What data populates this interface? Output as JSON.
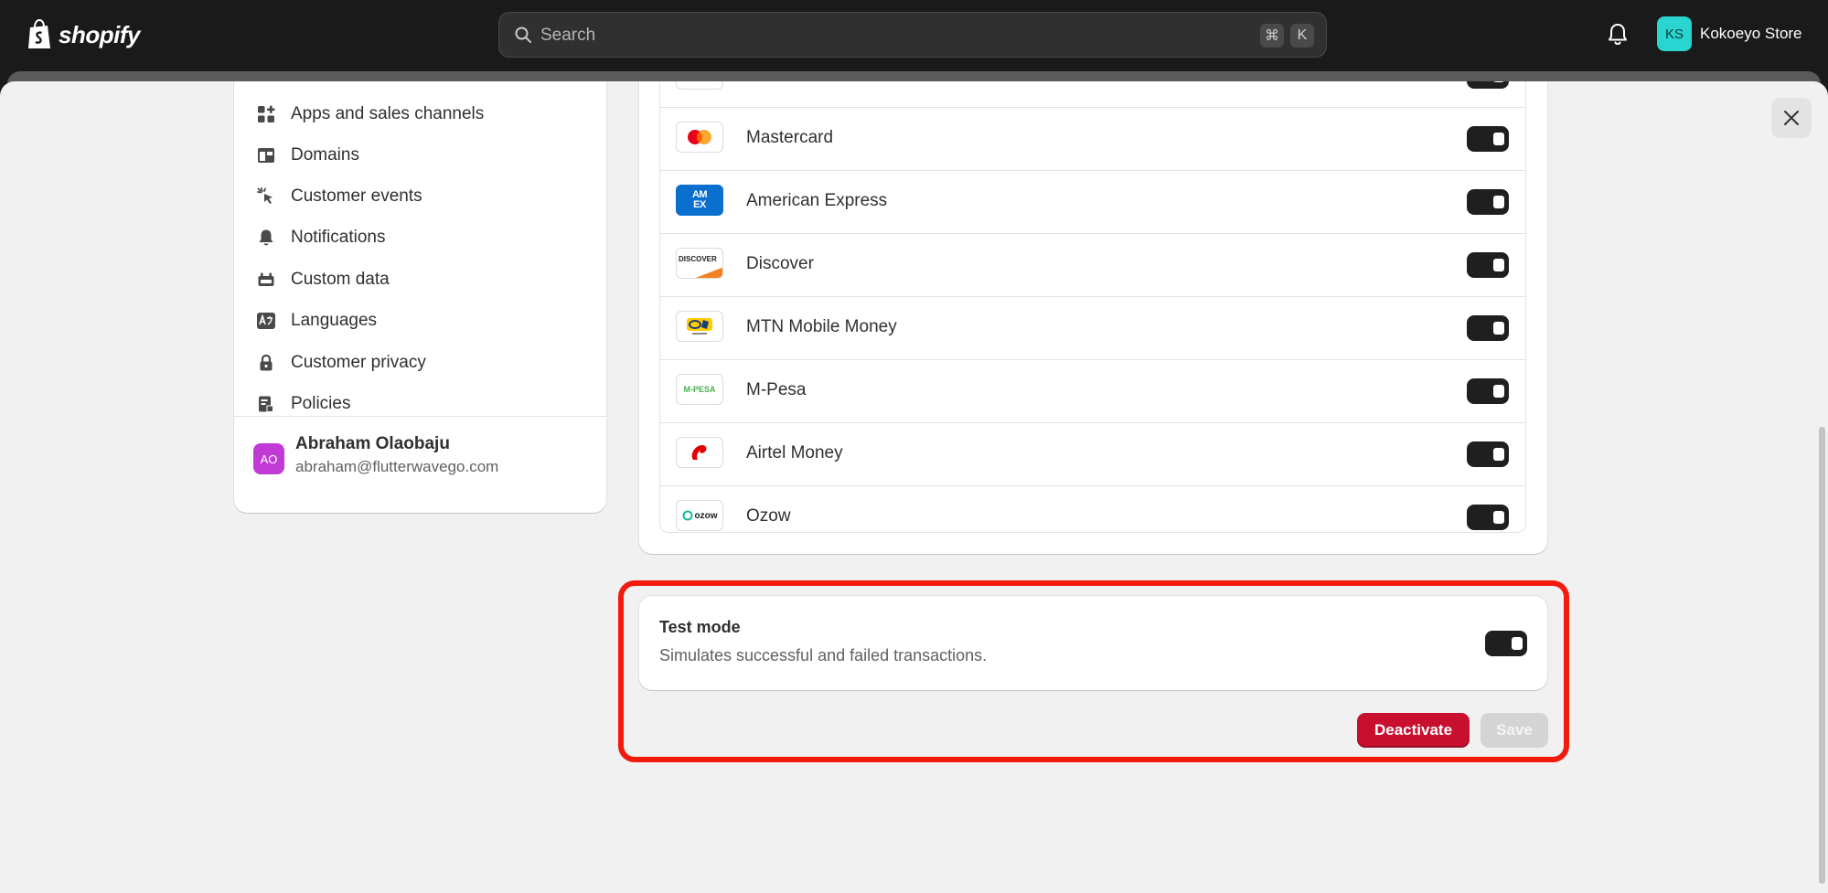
{
  "topbar": {
    "brand": "shopify",
    "search_placeholder": "Search",
    "shortcut_cmd": "⌘",
    "shortcut_key": "K",
    "store_initials": "KS",
    "store_name": "Kokoeyo Store"
  },
  "sidebar": {
    "items": [
      {
        "label": "Apps and sales channels",
        "icon": "apps-icon"
      },
      {
        "label": "Domains",
        "icon": "domains-icon"
      },
      {
        "label": "Customer events",
        "icon": "cursor-click-icon"
      },
      {
        "label": "Notifications",
        "icon": "bell-icon"
      },
      {
        "label": "Custom data",
        "icon": "custom-data-icon"
      },
      {
        "label": "Languages",
        "icon": "language-icon"
      },
      {
        "label": "Customer privacy",
        "icon": "lock-icon"
      },
      {
        "label": "Policies",
        "icon": "policies-icon"
      }
    ],
    "user": {
      "initials": "AO",
      "name": "Abraham Olaobaju",
      "email": "abraham@flutterwavego.com"
    }
  },
  "payment_methods": [
    {
      "name": "Mastercard",
      "enabled": true
    },
    {
      "name": "American Express",
      "enabled": true
    },
    {
      "name": "Discover",
      "enabled": true
    },
    {
      "name": "MTN Mobile Money",
      "enabled": true
    },
    {
      "name": "M-Pesa",
      "enabled": true
    },
    {
      "name": "Airtel Money",
      "enabled": true
    },
    {
      "name": "Ozow",
      "enabled": true
    }
  ],
  "logo_text": {
    "amex": "AM EX",
    "discover": "DISCOVER",
    "mpesa": "M-PESA",
    "ozow": "ozow"
  },
  "test_mode": {
    "title": "Test mode",
    "description": "Simulates successful and failed transactions.",
    "enabled": true
  },
  "actions": {
    "deactivate_label": "Deactivate",
    "save_label": "Save"
  },
  "colors": {
    "highlight": "#f31a0e",
    "deactivate": "#c8102e",
    "store_avatar": "#2ad4d0",
    "user_avatar": "#c13ad6"
  }
}
